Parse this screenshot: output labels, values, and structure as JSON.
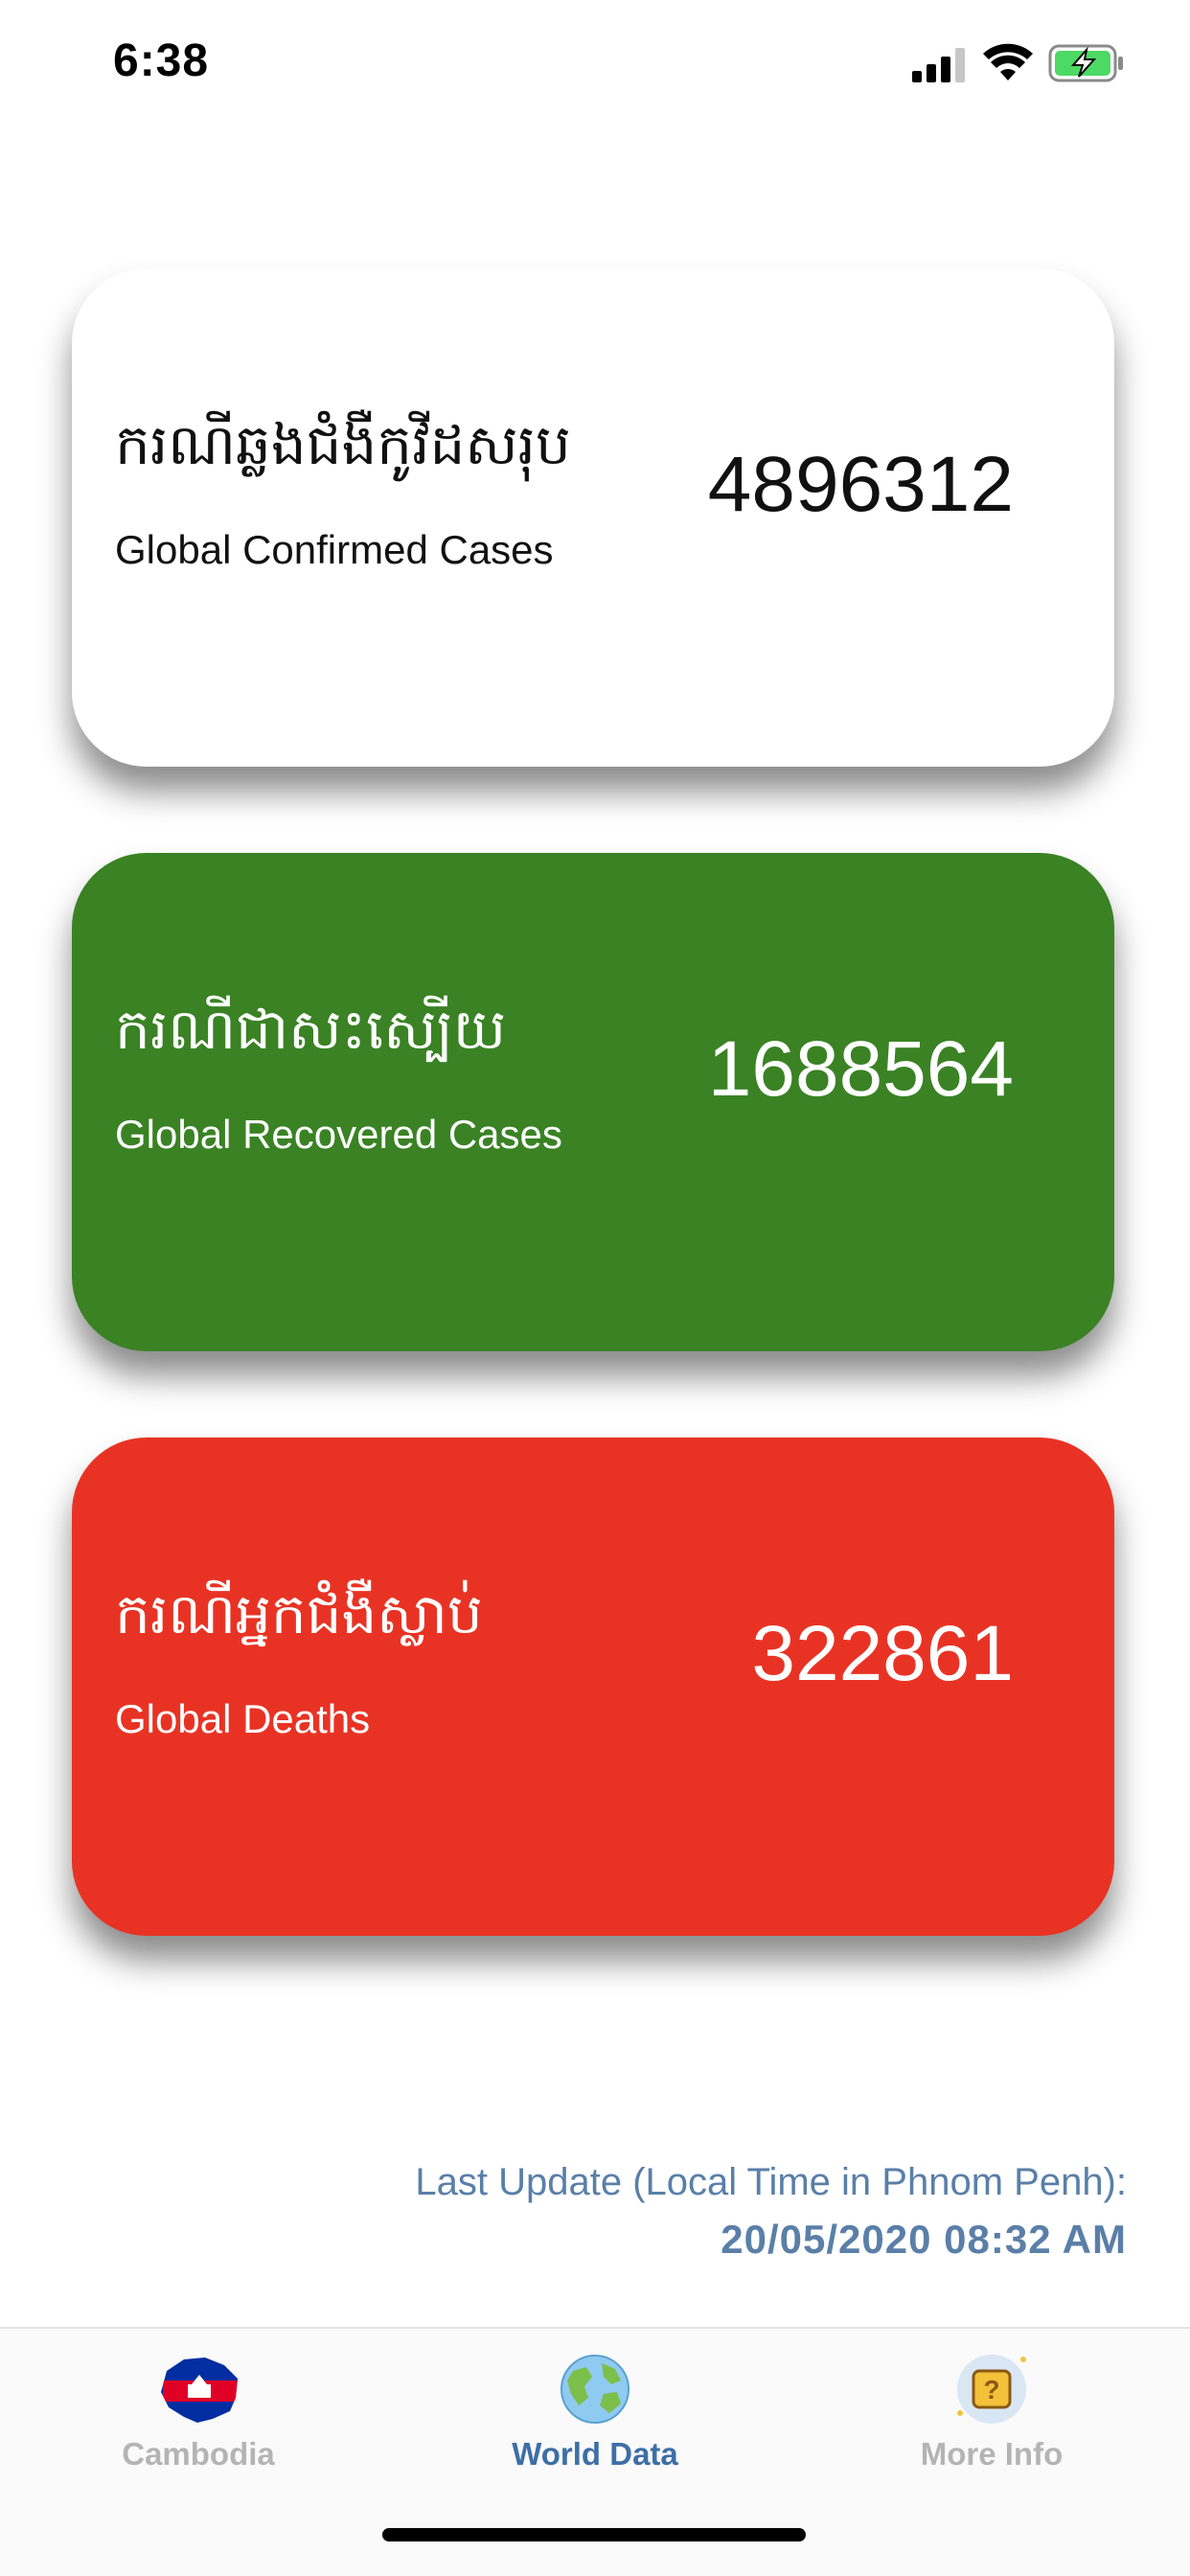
{
  "status_bar": {
    "time": "6:38",
    "icons": [
      "signal-icon",
      "wifi-icon",
      "battery-charging-icon"
    ]
  },
  "cards": {
    "confirmed": {
      "khmer_label": "ករណីឆ្លងជំងឺកូវីដសរុប",
      "english_label": "Global Confirmed Cases",
      "value": "4896312",
      "background": "#ffffff"
    },
    "recovered": {
      "khmer_label": "ករណីជាសះស្បើយ",
      "english_label": "Global Recovered Cases",
      "value": "1688564",
      "background": "#3a8224"
    },
    "deaths": {
      "khmer_label": "ករណីអ្នកជំងឺស្លាប់",
      "english_label": "Global Deaths",
      "value": "322861",
      "background": "#e83324"
    }
  },
  "last_update": {
    "label": "Last Update (Local Time in Phnom Penh):",
    "value": "20/05/2020 08:32 AM"
  },
  "tab_bar": {
    "tabs": [
      {
        "label": "Cambodia",
        "icon": "cambodia-map-flag-icon",
        "active": false
      },
      {
        "label": "World Data",
        "icon": "globe-icon",
        "active": true
      },
      {
        "label": "More Info",
        "icon": "question-mark-icon",
        "active": false
      }
    ],
    "active_color": "#3d6fa6",
    "inactive_color": "#b4b4b4"
  }
}
